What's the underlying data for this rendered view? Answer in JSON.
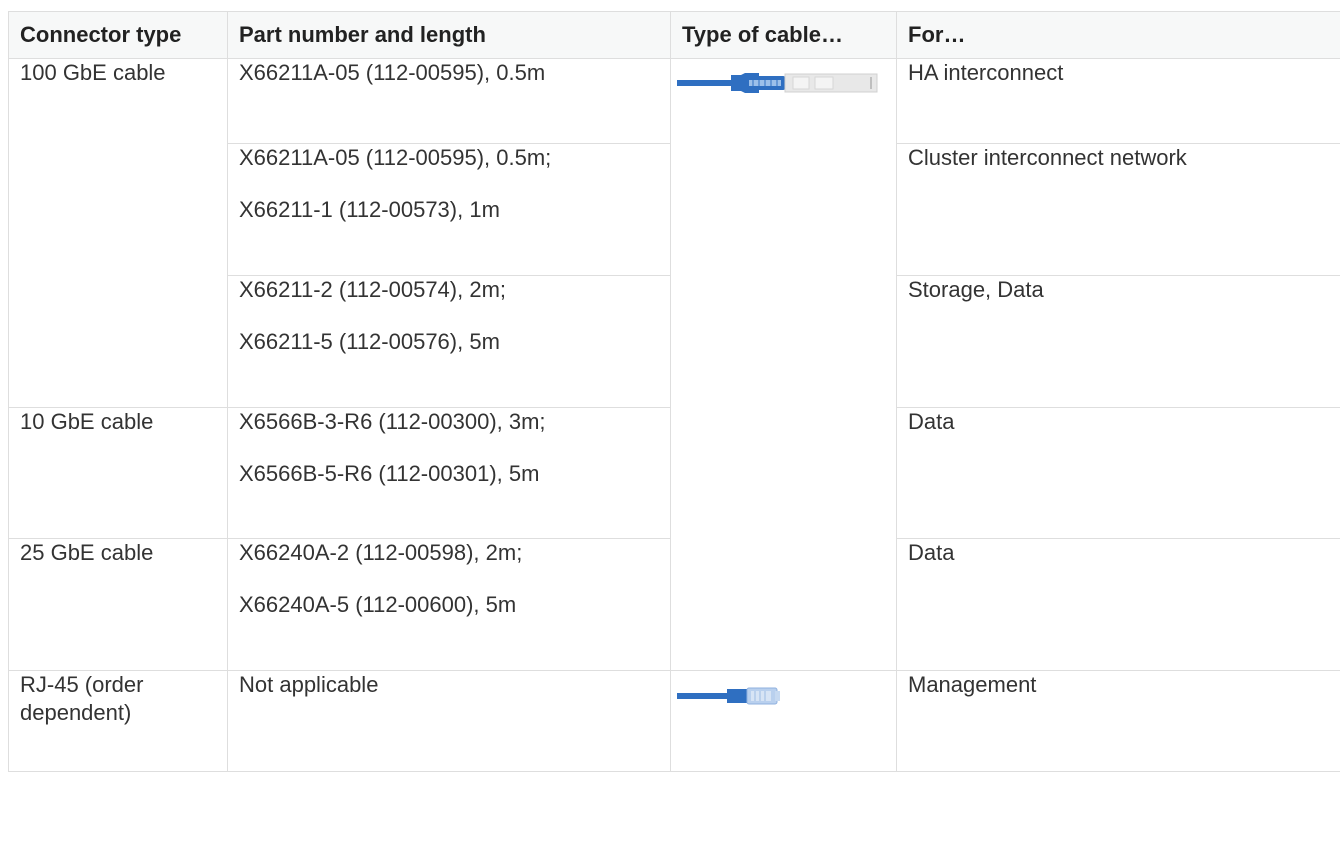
{
  "table": {
    "headers": [
      "Connector type",
      "Part number and length",
      "Type of cable…",
      "For…"
    ],
    "rows": [
      {
        "connector": "100 GbE cable",
        "parts": [
          "X66211A-05 (112-00595), 0.5m"
        ],
        "cable_icon": "qsfp-cable-icon",
        "for": "HA interconnect"
      },
      {
        "connector": "",
        "parts": [
          "X66211A-05 (112-00595), 0.5m;",
          "X66211-1 (112-00573), 1m"
        ],
        "for": "Cluster interconnect network"
      },
      {
        "connector": "",
        "parts": [
          "X66211-2 (112-00574), 2m;",
          "X66211-5 (112-00576), 5m"
        ],
        "for": "Storage, Data"
      },
      {
        "connector": "10 GbE cable",
        "parts": [
          "X6566B-3-R6 (112-00300), 3m;",
          "X6566B-5-R6 (112-00301), 5m"
        ],
        "for": "Data"
      },
      {
        "connector": "25 GbE cable",
        "parts": [
          "X66240A-2 (112-00598), 2m;",
          "X66240A-5 (112-00600), 5m"
        ],
        "for": "Data"
      },
      {
        "connector": "RJ-45 (order dependent)",
        "parts": [
          "Not applicable"
        ],
        "cable_icon": "rj45-cable-icon",
        "for": "Management"
      }
    ]
  },
  "colors": {
    "cable_blue": "#2f6fc1",
    "header_bg": "#f7f8f8",
    "border": "#dedede"
  }
}
